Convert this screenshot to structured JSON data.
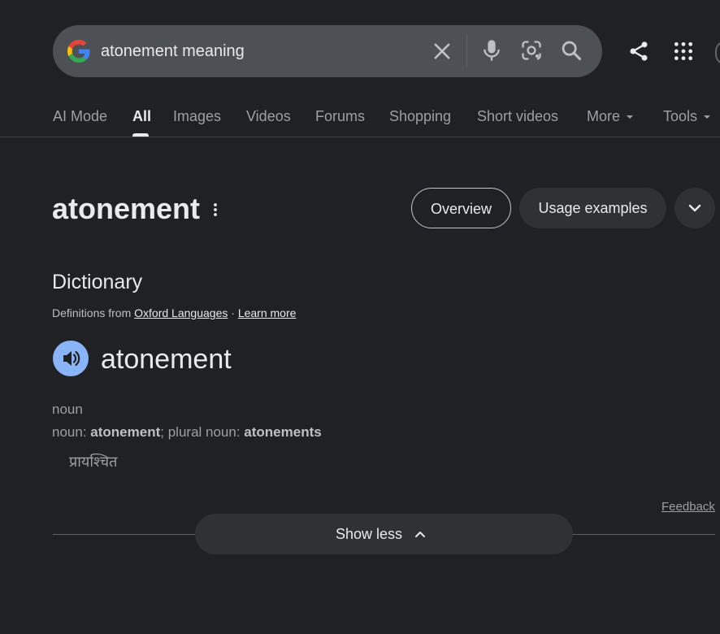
{
  "search": {
    "query": "atonement meaning"
  },
  "icons": {
    "logo": "google-g-logo",
    "clear": "close-icon",
    "voice": "mic-icon",
    "lens": "camera-lens-icon",
    "search": "search-icon",
    "share": "share-icon",
    "apps": "apps-grid-icon",
    "kebab": "more-vert-icon",
    "speaker": "speaker-icon",
    "expand": "chevron-down-icon",
    "collapse": "chevron-up-icon"
  },
  "tabs": [
    {
      "label": "AI Mode",
      "active": false
    },
    {
      "label": "All",
      "active": true
    },
    {
      "label": "Images",
      "active": false
    },
    {
      "label": "Videos",
      "active": false
    },
    {
      "label": "Forums",
      "active": false
    },
    {
      "label": "Shopping",
      "active": false
    },
    {
      "label": "Short videos",
      "active": false
    },
    {
      "label": "More",
      "active": false
    },
    {
      "label": "Tools",
      "active": false
    }
  ],
  "result": {
    "heading": "atonement",
    "overview_label": "Overview",
    "usage_label": "Usage examples"
  },
  "dictionary": {
    "title": "Dictionary",
    "defs_prefix": "Definitions from",
    "source_link": "Oxford Languages",
    "separator": "·",
    "learn_more": "Learn more",
    "word": "atonement",
    "part_of_speech": "noun",
    "forms": {
      "label1": "noun:",
      "form1": "atonement",
      "sep": ";",
      "label2": "plural noun:",
      "form2": "atonements"
    },
    "translation": "प्रायश्चित"
  },
  "footer": {
    "feedback": "Feedback",
    "show_less": "Show less"
  },
  "colors": {
    "background": "#202124",
    "search_bar": "#4d5156",
    "pill_bg": "#303134",
    "accent_blue": "#8ab4f8",
    "text_primary": "#e8eaed",
    "text_secondary": "#9aa0a6"
  }
}
